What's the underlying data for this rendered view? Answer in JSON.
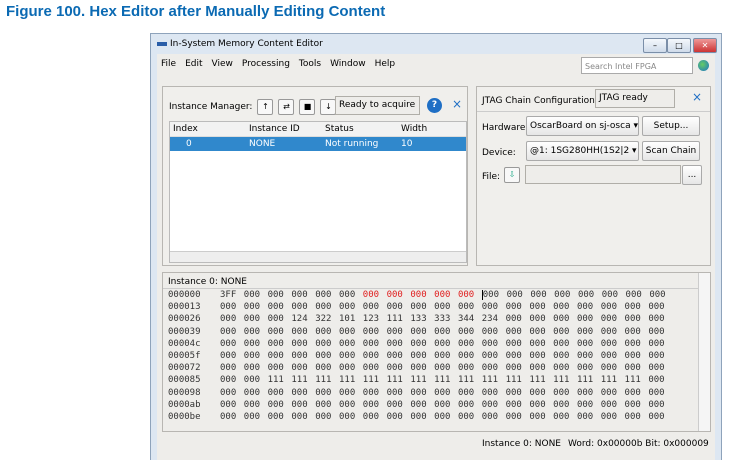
{
  "figure_caption": "Figure 100.  Hex Editor after Manually Editing Content",
  "window": {
    "title": "In-System Memory Content Editor",
    "min": "–",
    "max": "□",
    "close": "✕"
  },
  "menu": [
    "File",
    "Edit",
    "View",
    "Processing",
    "Tools",
    "Window",
    "Help"
  ],
  "search": {
    "placeholder": "Search Intel FPGA"
  },
  "instance_manager": {
    "label": "Instance Manager:",
    "status": "Ready to acquire",
    "help": "?",
    "close": "×",
    "columns": [
      "Index",
      "Instance ID",
      "Status",
      "Width"
    ],
    "rows": [
      [
        "0",
        "NONE",
        "Not running",
        "10"
      ]
    ]
  },
  "jtag": {
    "label": "JTAG Chain Configuration:",
    "status": "JTAG ready",
    "close": "×",
    "hardware_label": "Hardware:",
    "hardware": "OscarBoard on sj-osca",
    "setup": "Setup...",
    "device_label": "Device:",
    "device": "@1: 1SG280HH(1S2|2",
    "scan": "Scan Chain",
    "file_label": "File:",
    "file_browse": "..."
  },
  "hex_editor": {
    "title": "Instance 0: NONE",
    "rows": [
      {
        "addr": "000000",
        "values": [
          "3FF",
          "000",
          "000",
          "000",
          "000",
          "000",
          "000",
          "000",
          "000",
          "000",
          "000",
          "000",
          "000",
          "000",
          "000",
          "000",
          "000",
          "000",
          "000"
        ],
        "edited": [
          6,
          7,
          8,
          9,
          10
        ]
      },
      {
        "addr": "000013",
        "values": [
          "000",
          "000",
          "000",
          "000",
          "000",
          "000",
          "000",
          "000",
          "000",
          "000",
          "000",
          "000",
          "000",
          "000",
          "000",
          "000",
          "000",
          "000",
          "000"
        ]
      },
      {
        "addr": "000026",
        "values": [
          "000",
          "000",
          "000",
          "124",
          "322",
          "101",
          "123",
          "111",
          "133",
          "333",
          "344",
          "234",
          "000",
          "000",
          "000",
          "000",
          "000",
          "000",
          "000"
        ]
      },
      {
        "addr": "000039",
        "values": [
          "000",
          "000",
          "000",
          "000",
          "000",
          "000",
          "000",
          "000",
          "000",
          "000",
          "000",
          "000",
          "000",
          "000",
          "000",
          "000",
          "000",
          "000",
          "000"
        ]
      },
      {
        "addr": "00004c",
        "values": [
          "000",
          "000",
          "000",
          "000",
          "000",
          "000",
          "000",
          "000",
          "000",
          "000",
          "000",
          "000",
          "000",
          "000",
          "000",
          "000",
          "000",
          "000",
          "000"
        ]
      },
      {
        "addr": "00005f",
        "values": [
          "000",
          "000",
          "000",
          "000",
          "000",
          "000",
          "000",
          "000",
          "000",
          "000",
          "000",
          "000",
          "000",
          "000",
          "000",
          "000",
          "000",
          "000",
          "000"
        ]
      },
      {
        "addr": "000072",
        "values": [
          "000",
          "000",
          "000",
          "000",
          "000",
          "000",
          "000",
          "000",
          "000",
          "000",
          "000",
          "000",
          "000",
          "000",
          "000",
          "000",
          "000",
          "000",
          "000"
        ]
      },
      {
        "addr": "000085",
        "values": [
          "000",
          "000",
          "111",
          "111",
          "111",
          "111",
          "111",
          "111",
          "111",
          "111",
          "111",
          "111",
          "111",
          "111",
          "111",
          "111",
          "111",
          "111",
          "000"
        ]
      },
      {
        "addr": "000098",
        "values": [
          "000",
          "000",
          "000",
          "000",
          "000",
          "000",
          "000",
          "000",
          "000",
          "000",
          "000",
          "000",
          "000",
          "000",
          "000",
          "000",
          "000",
          "000",
          "000"
        ]
      },
      {
        "addr": "0000ab",
        "values": [
          "000",
          "000",
          "000",
          "000",
          "000",
          "000",
          "000",
          "000",
          "000",
          "000",
          "000",
          "000",
          "000",
          "000",
          "000",
          "000",
          "000",
          "000",
          "000"
        ]
      },
      {
        "addr": "0000be",
        "values": [
          "000",
          "000",
          "000",
          "000",
          "000",
          "000",
          "000",
          "000",
          "000",
          "000",
          "000",
          "000",
          "000",
          "000",
          "000",
          "000",
          "000",
          "000",
          "000"
        ]
      }
    ]
  },
  "status_bar": {
    "instance": "Instance 0: NONE",
    "position": "Word: 0x00000b  Bit: 0x000009"
  }
}
